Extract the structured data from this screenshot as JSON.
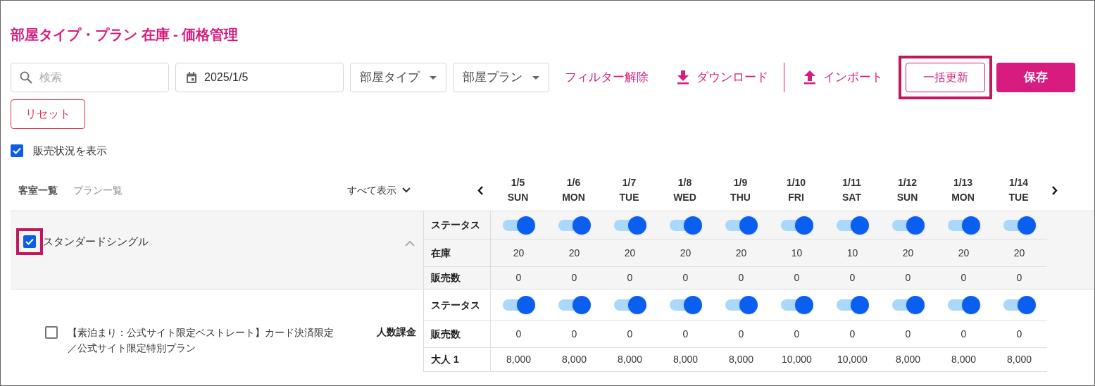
{
  "title": "部屋タイプ・プラン 在庫 - 価格管理",
  "toolbar": {
    "search": {
      "placeholder": "検索"
    },
    "date": {
      "value": "2025/1/5"
    },
    "dropdowns": [
      {
        "label": "部屋タイプ"
      },
      {
        "label": "部屋プラン"
      }
    ],
    "actions": [
      {
        "kind": "link",
        "label": "フィルター解除"
      },
      {
        "kind": "download",
        "label": "ダウンロード"
      },
      {
        "kind": "import",
        "label": "インポート"
      },
      {
        "kind": "outline",
        "label": "一括更新",
        "highlighted": true
      },
      {
        "kind": "primary",
        "label": "保存"
      }
    ],
    "reset": {
      "label": "リセット"
    }
  },
  "show_sales": {
    "label": "販売状況を表示",
    "checked": true
  },
  "view_tabs": [
    {
      "label": "客室一覧",
      "selected": true
    },
    {
      "label": "プラン一覧",
      "selected": false
    }
  ],
  "show_all": "すべて表示",
  "dates": [
    {
      "date": "1/5",
      "day": "SUN"
    },
    {
      "date": "1/6",
      "day": "MON"
    },
    {
      "date": "1/7",
      "day": "TUE"
    },
    {
      "date": "1/8",
      "day": "WED"
    },
    {
      "date": "1/9",
      "day": "THU"
    },
    {
      "date": "1/10",
      "day": "FRI"
    },
    {
      "date": "1/11",
      "day": "SAT"
    },
    {
      "date": "1/12",
      "day": "SUN"
    },
    {
      "date": "1/13",
      "day": "MON"
    },
    {
      "date": "1/14",
      "day": "TUE"
    }
  ],
  "room": {
    "name": "スタンダードシングル",
    "checked": true,
    "highlighted": true,
    "expanded": true,
    "rows": [
      {
        "kind": "toggles",
        "label": "ステータス",
        "toggles": [
          {
            "on": true
          },
          {
            "on": true
          },
          {
            "on": true
          },
          {
            "on": true
          },
          {
            "on": true
          },
          {
            "on": true
          },
          {
            "on": true
          },
          {
            "on": true
          },
          {
            "on": true
          },
          {
            "on": true
          }
        ]
      },
      {
        "kind": "numbers",
        "label": "在庫",
        "values": [
          "20",
          "20",
          "20",
          "20",
          "20",
          "10",
          "10",
          "20",
          "20",
          "20"
        ]
      },
      {
        "kind": "numbers",
        "label": "販売数",
        "values": [
          "0",
          "0",
          "0",
          "0",
          "0",
          "0",
          "0",
          "0",
          "0",
          "0"
        ]
      }
    ]
  },
  "plans": [
    {
      "name": "【素泊まり：公式サイト限定ベストレート】カード決済限定／公式サイト限定特別プラン",
      "checked": false,
      "billing": "人数課金",
      "rows": [
        {
          "kind": "toggles",
          "label": "ステータス",
          "toggles": [
            {
              "on": true
            },
            {
              "on": true
            },
            {
              "on": true
            },
            {
              "on": true
            },
            {
              "on": true
            },
            {
              "on": true
            },
            {
              "on": true
            },
            {
              "on": true
            },
            {
              "on": true
            },
            {
              "on": true
            }
          ]
        },
        {
          "kind": "numbers",
          "label": "販売数",
          "values": [
            "0",
            "0",
            "0",
            "0",
            "0",
            "0",
            "0",
            "0",
            "0",
            "0"
          ]
        },
        {
          "kind": "numbers",
          "label": "大人 1",
          "values": [
            "8,000",
            "8,000",
            "8,000",
            "8,000",
            "8,000",
            "10,000",
            "10,000",
            "8,000",
            "8,000",
            "8,000"
          ]
        }
      ]
    }
  ]
}
